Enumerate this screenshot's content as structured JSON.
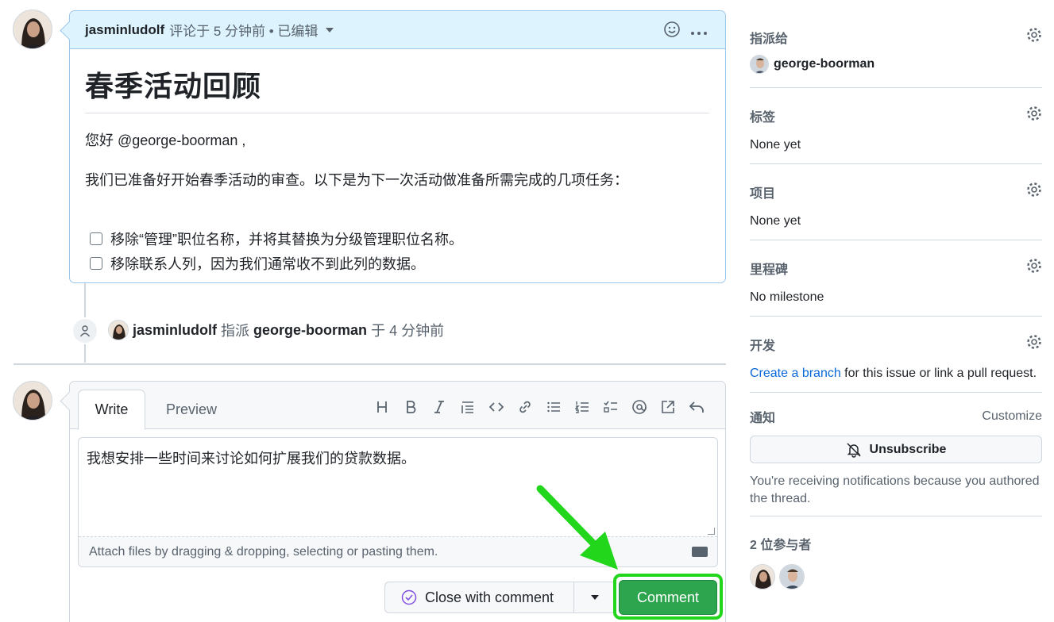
{
  "comment": {
    "author": "jasminludolf",
    "meta": "评论于 5 分钟前 • 已编辑",
    "title": "春季活动回顾",
    "greeting": "您好 @george-boorman ,",
    "intro": "我们已准备好开始春季活动的审查。以下是为下一次活动做准备所需完成的几项任务：",
    "tasks": [
      "移除“管理”职位名称，并将其替换为分级管理职位名称。",
      "移除联系人列，因为我们通常收不到此列的数据。"
    ]
  },
  "event": {
    "actor": "jasminludolf",
    "action": "指派",
    "target": "george-boorman",
    "time": "于 4 分钟前"
  },
  "composer": {
    "tab_write": "Write",
    "tab_preview": "Preview",
    "text": "我想安排一些时间来讨论如何扩展我们的贷款数据。",
    "attach_hint": "Attach files by dragging & dropping, selecting or pasting them.",
    "close_label": "Close with comment",
    "comment_label": "Comment",
    "toolbar_icons": [
      "heading-icon",
      "bold-icon",
      "italic-icon",
      "quote-icon",
      "code-icon",
      "link-icon",
      "unordered-list-icon",
      "ordered-list-icon",
      "task-list-icon",
      "mention-icon",
      "cross-reference-icon",
      "undo-icon"
    ]
  },
  "sidebar": {
    "assignees": {
      "label": "指派给",
      "value": "george-boorman"
    },
    "labels": {
      "label": "标签",
      "value": "None yet"
    },
    "projects": {
      "label": "项目",
      "value": "None yet"
    },
    "milestone": {
      "label": "里程碑",
      "value": "No milestone"
    },
    "development": {
      "label": "开发",
      "link": "Create a branch",
      "rest": " for this issue or link a pull request."
    },
    "notifications": {
      "label": "通知",
      "customize": "Customize",
      "button": "Unsubscribe",
      "note": "You're receiving notifications because you authored the thread."
    },
    "participants": {
      "label": "2 位参与者"
    }
  },
  "colors": {
    "accent": "#0969da",
    "primary_button": "#2da44e",
    "highlight": "#22d61c",
    "header_bg": "#ddf4ff"
  }
}
